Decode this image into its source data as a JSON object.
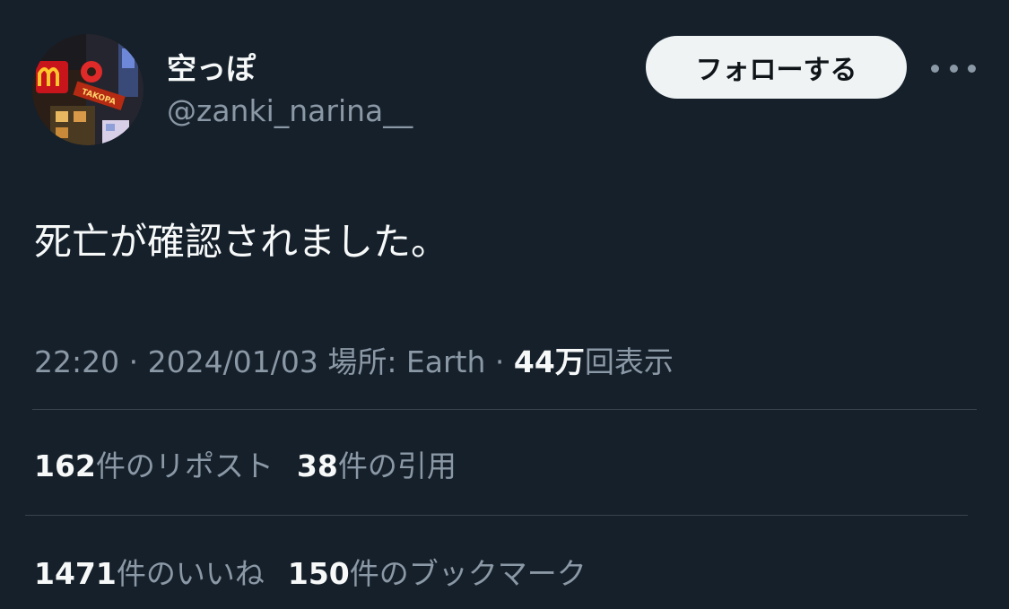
{
  "colors": {
    "background": "#15202b",
    "text_primary": "#f7f9f9",
    "text_secondary": "#8b98a5",
    "divider": "#38444d",
    "follow_button_bg": "#eff3f4",
    "follow_button_text": "#0f1419"
  },
  "user": {
    "display_name": "空っぽ",
    "handle": "@zanki_narina__",
    "avatar_icon": "avatar-photo-icon",
    "avatar_sign_text": "TAKOPA"
  },
  "header": {
    "follow_label": "フォローする",
    "more_icon": "more-options-icon"
  },
  "tweet": {
    "text": "死亡が確認されました。"
  },
  "meta": {
    "time": "22:20",
    "separator": "·",
    "date": "2024/01/03",
    "location_label": "場所: Earth",
    "views_count": "44万",
    "views_label": "回表示"
  },
  "stats": {
    "reposts": {
      "count": "162",
      "label": "件のリポスト"
    },
    "quotes": {
      "count": "38",
      "label": "件の引用"
    },
    "likes": {
      "count": "1471",
      "label": "件のいいね"
    },
    "bookmarks": {
      "count": "150",
      "label": "件のブックマーク"
    }
  }
}
